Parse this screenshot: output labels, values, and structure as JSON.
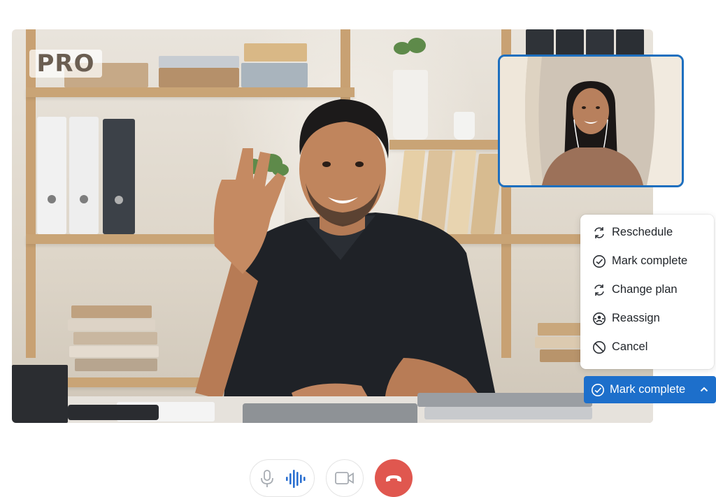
{
  "badge": {
    "label": "PRO"
  },
  "menu": {
    "items": [
      {
        "label": "Reschedule",
        "icon": "refresh-icon"
      },
      {
        "label": "Mark complete",
        "icon": "check-circle-icon"
      },
      {
        "label": "Change plan",
        "icon": "refresh-icon"
      },
      {
        "label": "Reassign",
        "icon": "reassign-icon"
      },
      {
        "label": "Cancel",
        "icon": "ban-icon"
      }
    ]
  },
  "action_button": {
    "label": "Mark complete",
    "icon": "check-circle-icon",
    "toggle_icon": "chevron-up-icon"
  },
  "controls": {
    "mic_icon": "microphone-icon",
    "audio_icon": "audio-wave-icon",
    "camera_icon": "video-camera-icon",
    "end_icon": "phone-hangup-icon"
  },
  "colors": {
    "accent": "#1d6fcb",
    "pip_border": "#1d6fbf",
    "end_call": "#e0574f",
    "audio_wave": "#2a6fd0"
  }
}
